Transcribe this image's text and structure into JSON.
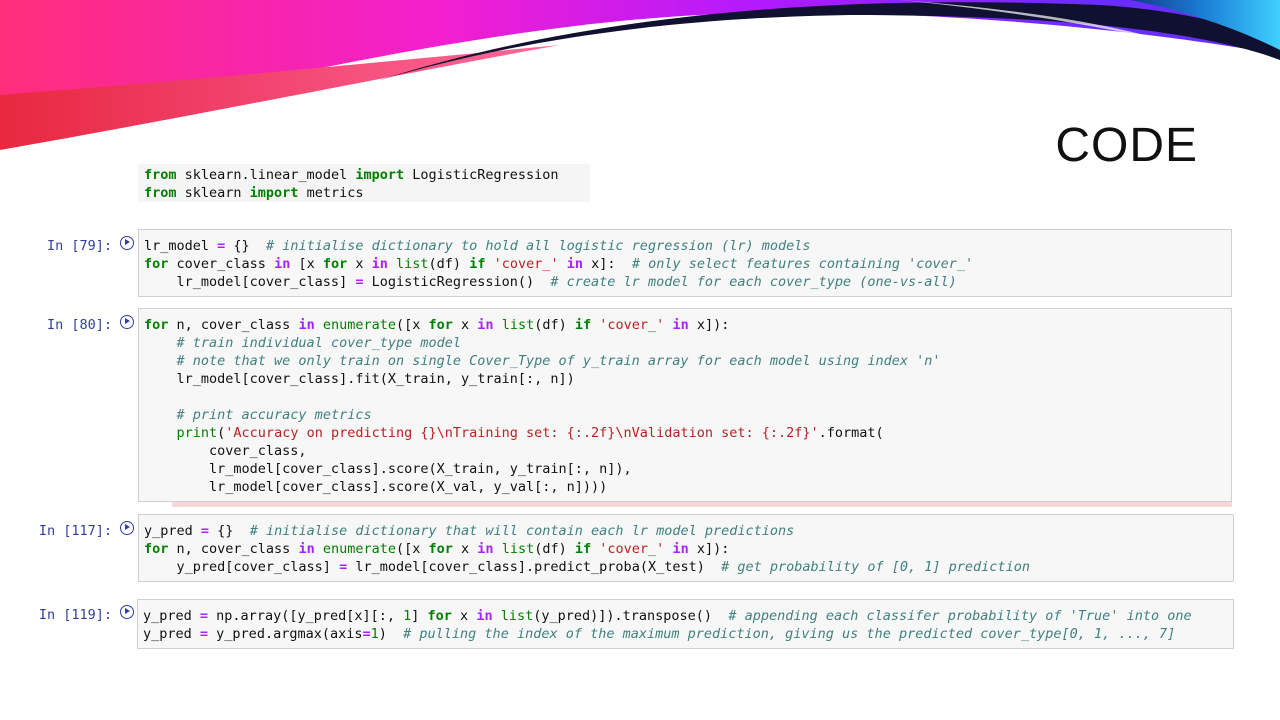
{
  "slide": {
    "title": "CODE"
  },
  "imports": {
    "line1": {
      "kw1": "from",
      "mod": " sklearn.linear_model ",
      "kw2": "import",
      "name": " LogisticRegression"
    },
    "line2": {
      "kw1": "from",
      "mod": " sklearn ",
      "kw2": "import",
      "name": " metrics"
    }
  },
  "cells": [
    {
      "prompt": "In [79]:"
    },
    {
      "prompt": "In [80]:"
    },
    {
      "prompt": "In [117]:"
    },
    {
      "prompt": "In [119]:"
    }
  ]
}
